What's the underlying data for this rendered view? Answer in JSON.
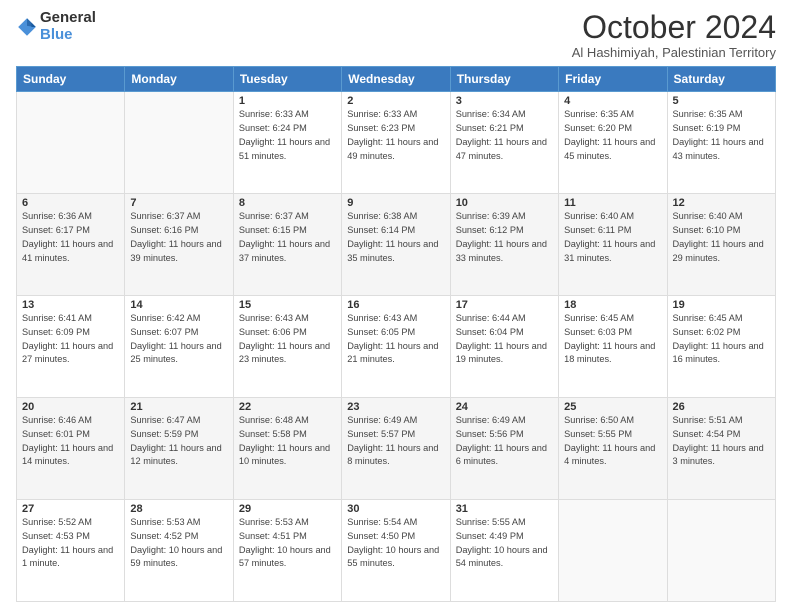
{
  "logo": {
    "general": "General",
    "blue": "Blue"
  },
  "header": {
    "month": "October 2024",
    "location": "Al Hashimiyah, Palestinian Territory"
  },
  "weekdays": [
    "Sunday",
    "Monday",
    "Tuesday",
    "Wednesday",
    "Thursday",
    "Friday",
    "Saturday"
  ],
  "weeks": [
    [
      {
        "day": "",
        "info": ""
      },
      {
        "day": "",
        "info": ""
      },
      {
        "day": "1",
        "sunrise": "6:33 AM",
        "sunset": "6:24 PM",
        "daylight": "11 hours and 51 minutes."
      },
      {
        "day": "2",
        "sunrise": "6:33 AM",
        "sunset": "6:23 PM",
        "daylight": "11 hours and 49 minutes."
      },
      {
        "day": "3",
        "sunrise": "6:34 AM",
        "sunset": "6:21 PM",
        "daylight": "11 hours and 47 minutes."
      },
      {
        "day": "4",
        "sunrise": "6:35 AM",
        "sunset": "6:20 PM",
        "daylight": "11 hours and 45 minutes."
      },
      {
        "day": "5",
        "sunrise": "6:35 AM",
        "sunset": "6:19 PM",
        "daylight": "11 hours and 43 minutes."
      }
    ],
    [
      {
        "day": "6",
        "sunrise": "6:36 AM",
        "sunset": "6:17 PM",
        "daylight": "11 hours and 41 minutes."
      },
      {
        "day": "7",
        "sunrise": "6:37 AM",
        "sunset": "6:16 PM",
        "daylight": "11 hours and 39 minutes."
      },
      {
        "day": "8",
        "sunrise": "6:37 AM",
        "sunset": "6:15 PM",
        "daylight": "11 hours and 37 minutes."
      },
      {
        "day": "9",
        "sunrise": "6:38 AM",
        "sunset": "6:14 PM",
        "daylight": "11 hours and 35 minutes."
      },
      {
        "day": "10",
        "sunrise": "6:39 AM",
        "sunset": "6:12 PM",
        "daylight": "11 hours and 33 minutes."
      },
      {
        "day": "11",
        "sunrise": "6:40 AM",
        "sunset": "6:11 PM",
        "daylight": "11 hours and 31 minutes."
      },
      {
        "day": "12",
        "sunrise": "6:40 AM",
        "sunset": "6:10 PM",
        "daylight": "11 hours and 29 minutes."
      }
    ],
    [
      {
        "day": "13",
        "sunrise": "6:41 AM",
        "sunset": "6:09 PM",
        "daylight": "11 hours and 27 minutes."
      },
      {
        "day": "14",
        "sunrise": "6:42 AM",
        "sunset": "6:07 PM",
        "daylight": "11 hours and 25 minutes."
      },
      {
        "day": "15",
        "sunrise": "6:43 AM",
        "sunset": "6:06 PM",
        "daylight": "11 hours and 23 minutes."
      },
      {
        "day": "16",
        "sunrise": "6:43 AM",
        "sunset": "6:05 PM",
        "daylight": "11 hours and 21 minutes."
      },
      {
        "day": "17",
        "sunrise": "6:44 AM",
        "sunset": "6:04 PM",
        "daylight": "11 hours and 19 minutes."
      },
      {
        "day": "18",
        "sunrise": "6:45 AM",
        "sunset": "6:03 PM",
        "daylight": "11 hours and 18 minutes."
      },
      {
        "day": "19",
        "sunrise": "6:45 AM",
        "sunset": "6:02 PM",
        "daylight": "11 hours and 16 minutes."
      }
    ],
    [
      {
        "day": "20",
        "sunrise": "6:46 AM",
        "sunset": "6:01 PM",
        "daylight": "11 hours and 14 minutes."
      },
      {
        "day": "21",
        "sunrise": "6:47 AM",
        "sunset": "5:59 PM",
        "daylight": "11 hours and 12 minutes."
      },
      {
        "day": "22",
        "sunrise": "6:48 AM",
        "sunset": "5:58 PM",
        "daylight": "11 hours and 10 minutes."
      },
      {
        "day": "23",
        "sunrise": "6:49 AM",
        "sunset": "5:57 PM",
        "daylight": "11 hours and 8 minutes."
      },
      {
        "day": "24",
        "sunrise": "6:49 AM",
        "sunset": "5:56 PM",
        "daylight": "11 hours and 6 minutes."
      },
      {
        "day": "25",
        "sunrise": "6:50 AM",
        "sunset": "5:55 PM",
        "daylight": "11 hours and 4 minutes."
      },
      {
        "day": "26",
        "sunrise": "5:51 AM",
        "sunset": "4:54 PM",
        "daylight": "11 hours and 3 minutes."
      }
    ],
    [
      {
        "day": "27",
        "sunrise": "5:52 AM",
        "sunset": "4:53 PM",
        "daylight": "11 hours and 1 minute."
      },
      {
        "day": "28",
        "sunrise": "5:53 AM",
        "sunset": "4:52 PM",
        "daylight": "10 hours and 59 minutes."
      },
      {
        "day": "29",
        "sunrise": "5:53 AM",
        "sunset": "4:51 PM",
        "daylight": "10 hours and 57 minutes."
      },
      {
        "day": "30",
        "sunrise": "5:54 AM",
        "sunset": "4:50 PM",
        "daylight": "10 hours and 55 minutes."
      },
      {
        "day": "31",
        "sunrise": "5:55 AM",
        "sunset": "4:49 PM",
        "daylight": "10 hours and 54 minutes."
      },
      {
        "day": "",
        "info": ""
      },
      {
        "day": "",
        "info": ""
      }
    ]
  ]
}
